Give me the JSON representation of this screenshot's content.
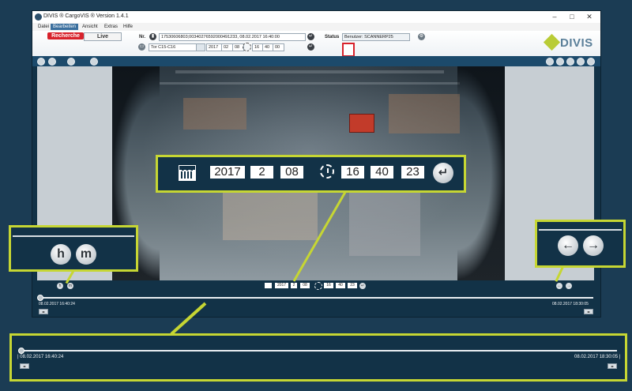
{
  "window": {
    "title": "DIVIS ® CargoVIS ® Version 1.4.1",
    "controls": {
      "minimize": "–",
      "maximize": "□",
      "close": "✕"
    }
  },
  "menu": [
    "Datei",
    "Bearbeiten",
    "Ansicht",
    "Extras",
    "Hilfe"
  ],
  "toolbar": {
    "tab_recherche": "Recherche",
    "tab_live": "Live",
    "nr_label": "Nr.",
    "nr_value": "17530606803;00340276592000491233, 08.02.2017 16:40:00",
    "camera_value": "Tor C15-C16",
    "date": {
      "year": "2017",
      "month": "02",
      "day": "08"
    },
    "time": {
      "hour": "16",
      "minute": "40",
      "second": "00"
    },
    "status_label": "Status",
    "user_label": "Benutzer: SCANNERP25"
  },
  "logo": {
    "text": "DIVIS",
    "color": "#5a7f99"
  },
  "datetime_callout": {
    "year": "2017",
    "month": "2",
    "day": "08",
    "hour": "16",
    "minute": "40",
    "second": "23",
    "enter_symbol": "↵"
  },
  "controls_row": {
    "year": "2017",
    "month": "2",
    "day": "08",
    "hour": "16",
    "minute": "40",
    "second": "23",
    "h_label": "h",
    "m_label": "m"
  },
  "timeline": {
    "start": "08.02.2017 16:40:24",
    "end": "08.02.2017 18:30:05",
    "btn_symbol": "◂▸"
  },
  "hm_callout": {
    "h_label": "h",
    "m_label": "m"
  },
  "arrow_callout": {
    "prev_symbol": "←",
    "next_symbol": "→"
  },
  "timeline_callout": {
    "start": "| 08.02.2017 16:40:24",
    "end": "08.02.2017 18:30:05 |",
    "btn_symbol": "◂▸"
  },
  "colors": {
    "highlight": "#c6d633",
    "background": "#1b3c54",
    "accent_red": "#d8222b"
  },
  "icons": [
    "calendar-icon",
    "clock-icon",
    "enter-icon",
    "prev-arrow-icon",
    "next-arrow-icon",
    "settings-icon"
  ]
}
